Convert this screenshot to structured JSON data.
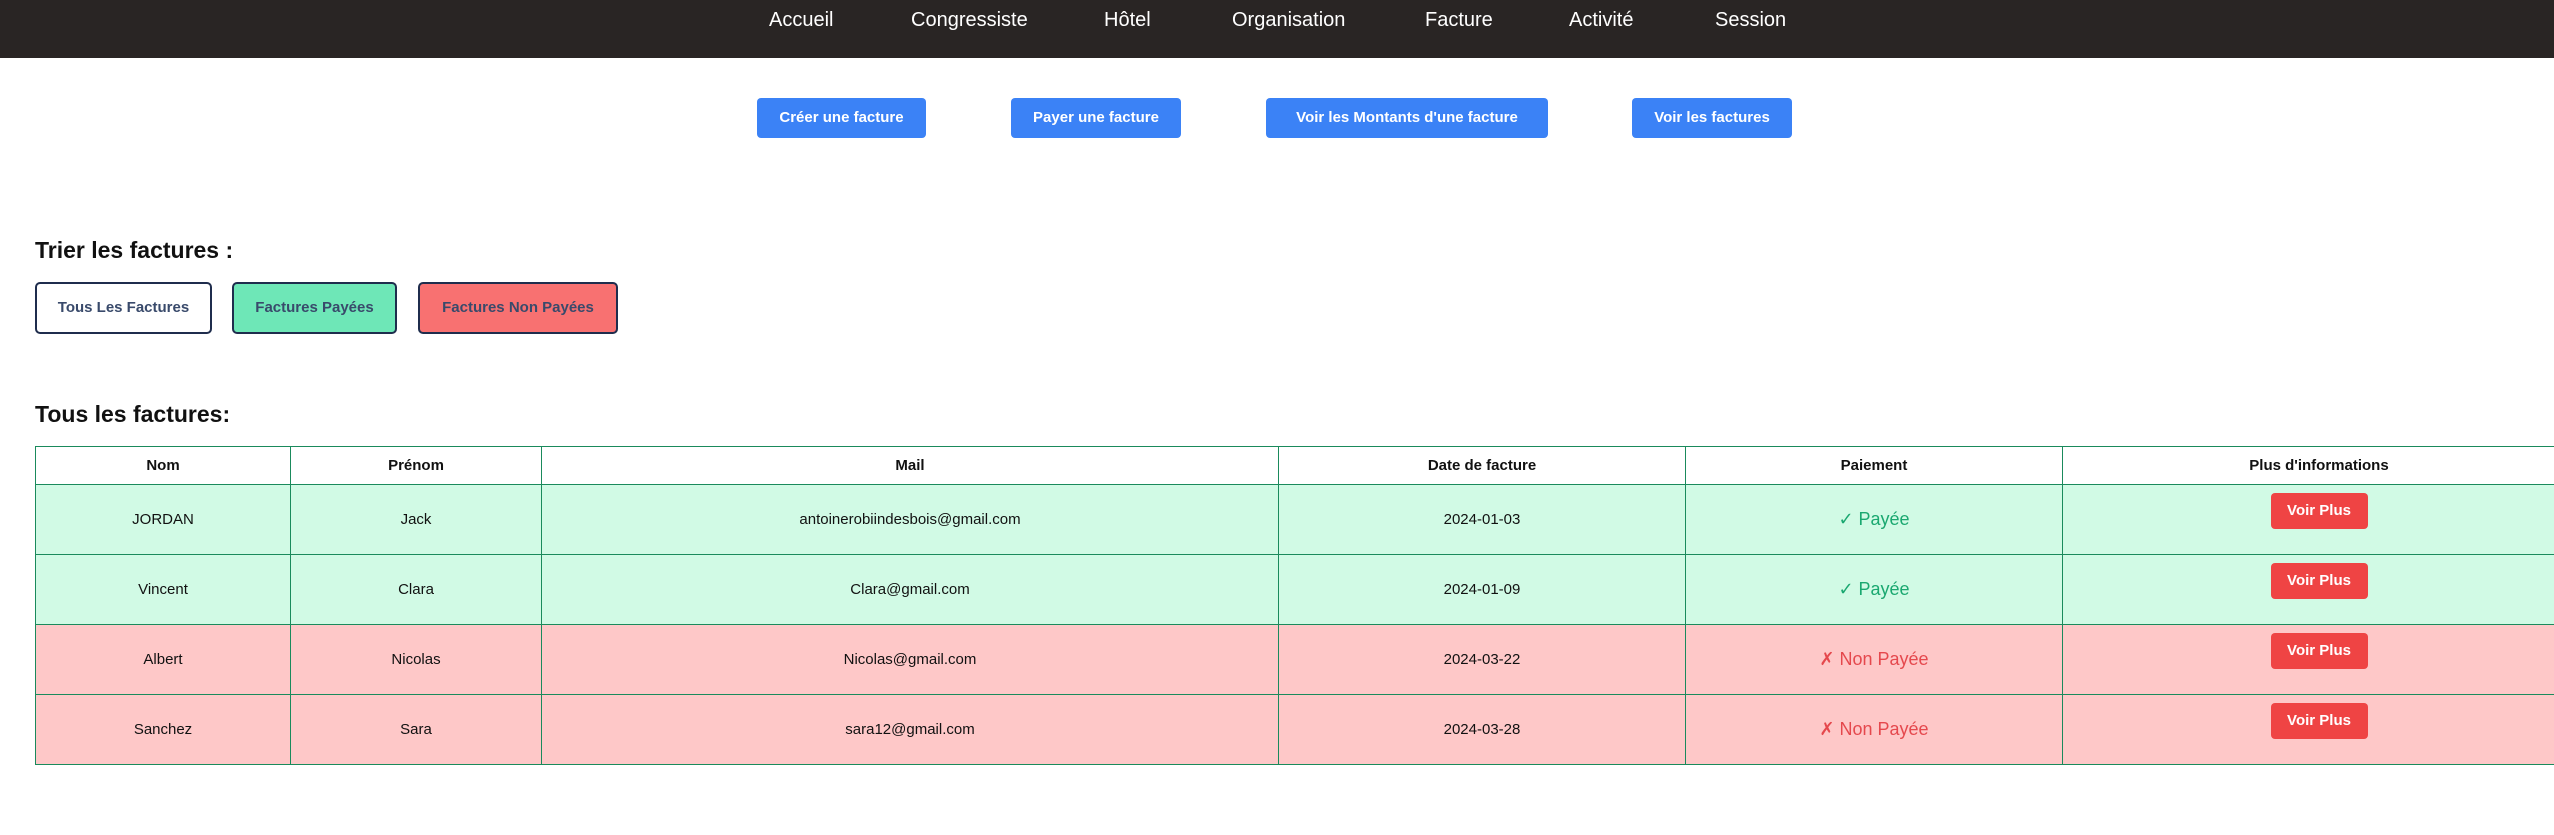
{
  "nav": {
    "items": [
      {
        "label": "Accueil"
      },
      {
        "label": "Congressiste"
      },
      {
        "label": "Hôtel"
      },
      {
        "label": "Organisation"
      },
      {
        "label": "Facture"
      },
      {
        "label": "Activité"
      },
      {
        "label": "Session"
      }
    ]
  },
  "actions": [
    {
      "label": "Créer une facture"
    },
    {
      "label": "Payer une facture"
    },
    {
      "label": "Voir les Montants d'une facture"
    },
    {
      "label": "Voir les factures"
    }
  ],
  "filters": {
    "title": "Trier les factures :",
    "buttons": [
      {
        "label": "Tous Les Factures",
        "color": "#ffffff"
      },
      {
        "label": "Factures Payées",
        "color": "#6ee7b7"
      },
      {
        "label": "Factures Non Payées",
        "color": "#f87171"
      }
    ]
  },
  "table": {
    "title": "Tous les factures:",
    "headers": [
      "Nom",
      "Prénom",
      "Mail",
      "Date de facture",
      "Paiement",
      "Plus d'informations"
    ],
    "rows": [
      {
        "nom": "JORDAN",
        "prenom": "Jack",
        "mail": "antoinerobiindesbois@gmail.com",
        "date": "2024-01-03",
        "status": "✓ Payée",
        "paid": true,
        "action": "Voir Plus"
      },
      {
        "nom": "Vincent",
        "prenom": "Clara",
        "mail": "Clara@gmail.com",
        "date": "2024-01-09",
        "status": "✓ Payée",
        "paid": true,
        "action": "Voir Plus"
      },
      {
        "nom": "Albert",
        "prenom": "Nicolas",
        "mail": "Nicolas@gmail.com",
        "date": "2024-03-22",
        "status": "✗ Non Payée",
        "paid": false,
        "action": "Voir Plus"
      },
      {
        "nom": "Sanchez",
        "prenom": "Sara",
        "mail": "sara12@gmail.com",
        "date": "2024-03-28",
        "status": "✗ Non Payée",
        "paid": false,
        "action": "Voir Plus"
      }
    ]
  },
  "colors": {
    "nav_bg": "#292524",
    "primary": "#3b82f6",
    "danger": "#ef4444",
    "paid_row": "#d1fae5",
    "unpaid_row": "#fec8c8",
    "table_border": "#1a8a5c"
  }
}
